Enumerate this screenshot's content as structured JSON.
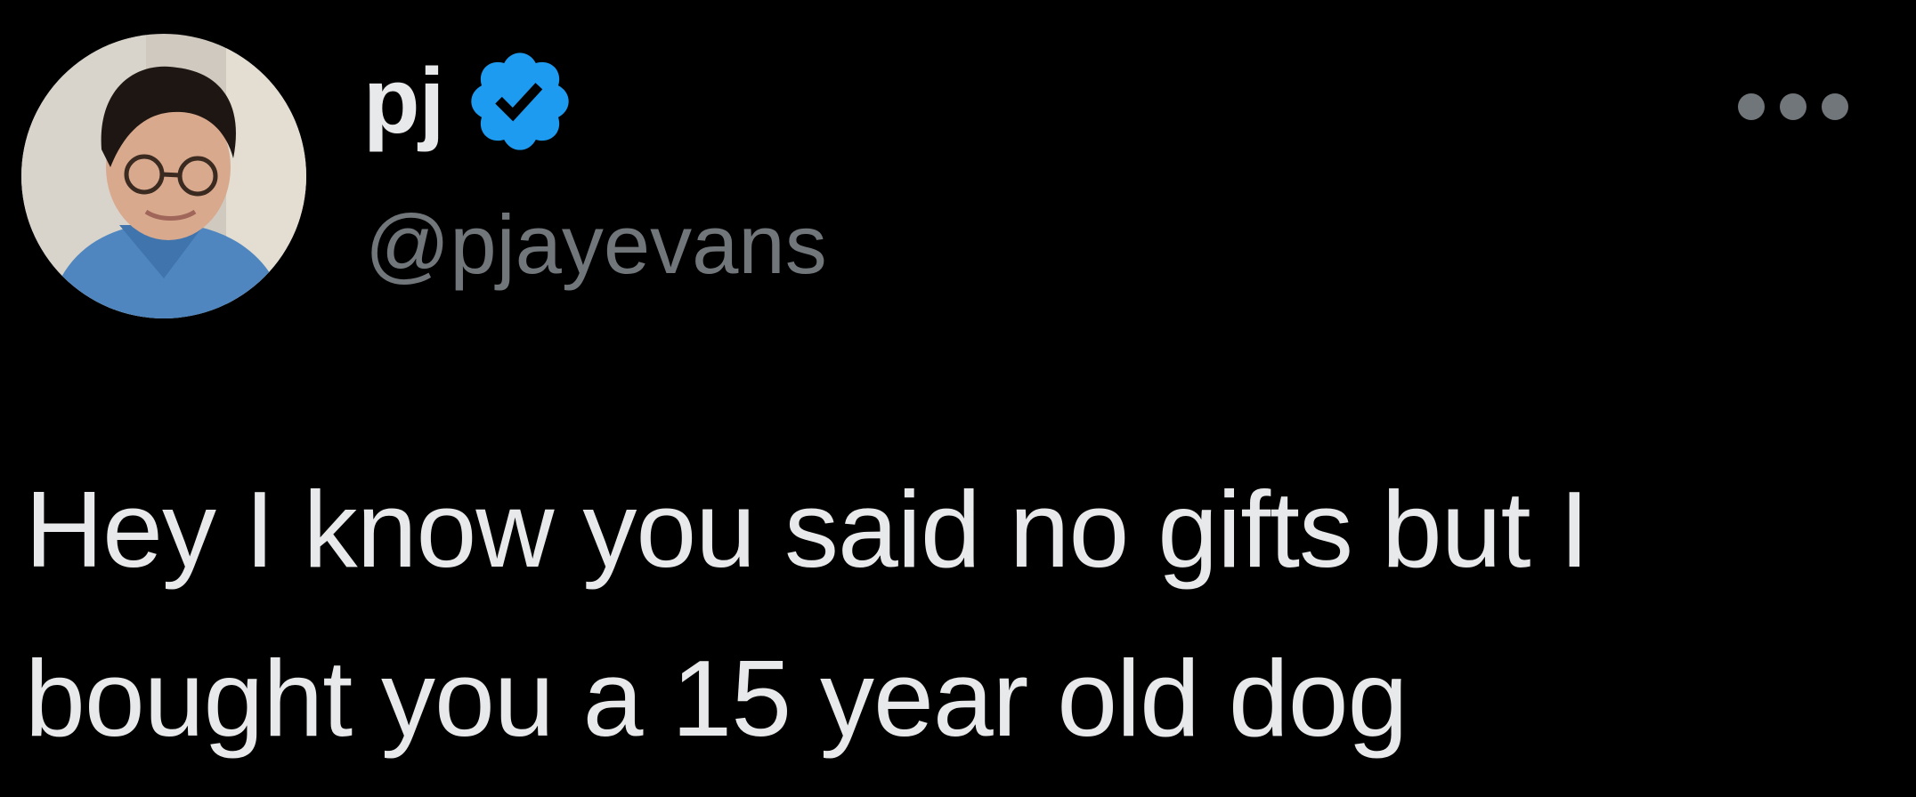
{
  "tweet": {
    "author": {
      "display_name": "pj",
      "handle": "@pjayevans",
      "verified": true,
      "avatar_icon": "profile-photo"
    },
    "more_icon": "more-horizontal-icon",
    "text_lines": [
      "Hey I know you said no gifts but I",
      "bought you a 15 year old dog"
    ]
  },
  "colors": {
    "background": "#000000",
    "primary_text": "#e7e9ea",
    "secondary_text": "#71767b",
    "verified_badge": "#1d9bf0"
  }
}
